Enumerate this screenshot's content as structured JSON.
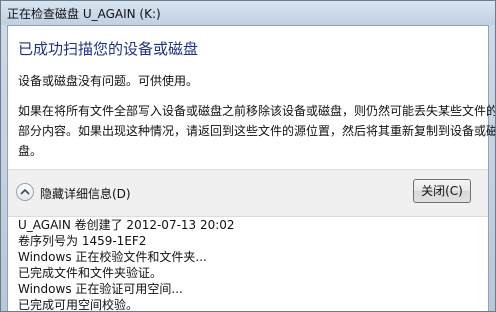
{
  "window": {
    "title": "正在检查磁盘 U_AGAIN (K:)"
  },
  "main": {
    "heading": "已成功扫描您的设备或磁盘",
    "status": "设备或磁盘没有问题。可供使用。",
    "advice_lines": [
      "如果在将所有文件全部写入设备或磁盘之前移除该设备或磁盘，则仍然可能丢失某些文件的",
      "部分内容。如果出现这种情况，请返回到这些文件的源位置，然后将其重新复制到设备或磁",
      "盘。"
    ]
  },
  "details": {
    "toggle_label": "隐藏详细信息(D)",
    "toggle_icon": "chevron-up-icon",
    "close_label": "关闭(C)",
    "log_lines": [
      "U_AGAIN 卷创建了 2012-07-13 20:02",
      "卷序列号为 1459-1EF2",
      "Windows 正在校验文件和文件夹...",
      "已完成文件和文件夹验证。",
      "Windows 正在验证可用空间...",
      "已完成可用空间校验。"
    ]
  }
}
